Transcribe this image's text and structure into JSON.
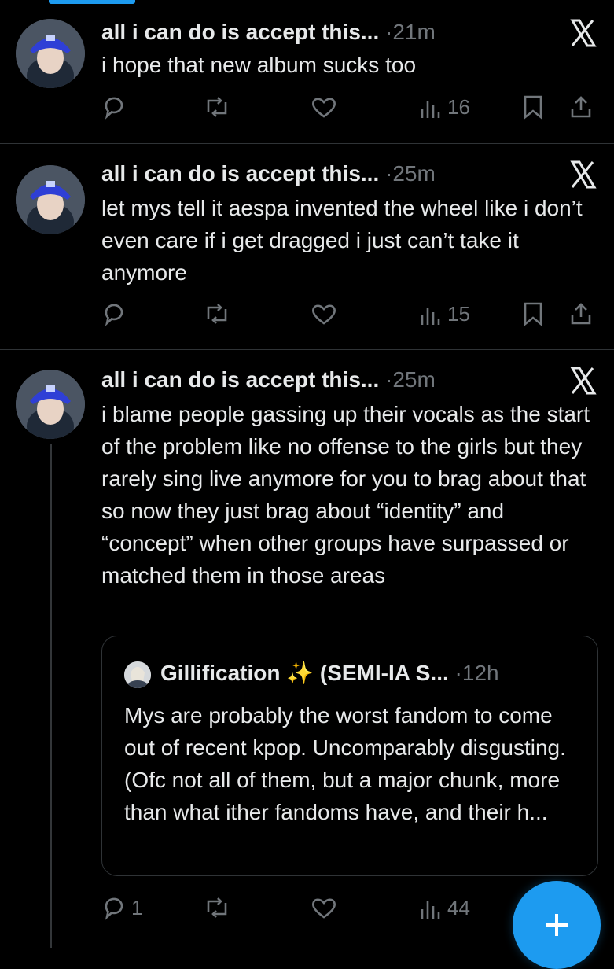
{
  "tweets": [
    {
      "author": "all i can do is accept this...",
      "separator": "·",
      "time": "21m",
      "text": "i hope that new album sucks too",
      "actions": {
        "replies": "",
        "retweets": "",
        "likes": "",
        "views": "16"
      }
    },
    {
      "author": "all i can do is accept this...",
      "separator": "·",
      "time": "25m",
      "text": "let mys tell it aespa invented the wheel like i don’t even care if i get dragged i just can’t take it anymore",
      "actions": {
        "replies": "",
        "retweets": "",
        "likes": "",
        "views": "15"
      }
    },
    {
      "author": "all i can do is accept this...",
      "separator": "·",
      "time": "25m",
      "text": "i blame people gassing up their vocals as the start of the problem like no offense to the girls but they rarely sing live anymore for you to brag about that so now they just brag about “identity” and “concept” when other groups have surpassed or matched them in those areas",
      "quote": {
        "author": "Gillification",
        "emoji": "✨",
        "author_suffix": "(SEMI-IA S...",
        "separator": "·",
        "time": "12h",
        "text": "Mys are probably the worst fandom to come out of recent kpop. Uncomparably disgusting. (Ofc not all of them, but a major chunk, more than what ither fandoms have, and their h..."
      },
      "actions": {
        "replies": "1",
        "retweets": "",
        "likes": "",
        "views": "44"
      }
    }
  ],
  "icons": {
    "reply": "speech-bubble-icon",
    "retweet": "retweet-icon",
    "like": "heart-icon",
    "views": "bar-chart-icon",
    "bookmark": "bookmark-icon",
    "share": "share-icon",
    "more": "x-icon",
    "compose": "plus-icon"
  },
  "colors": {
    "accent": "#1d9bf0",
    "background": "#000000",
    "muted": "#71767b",
    "text": "#e7e9ea"
  }
}
